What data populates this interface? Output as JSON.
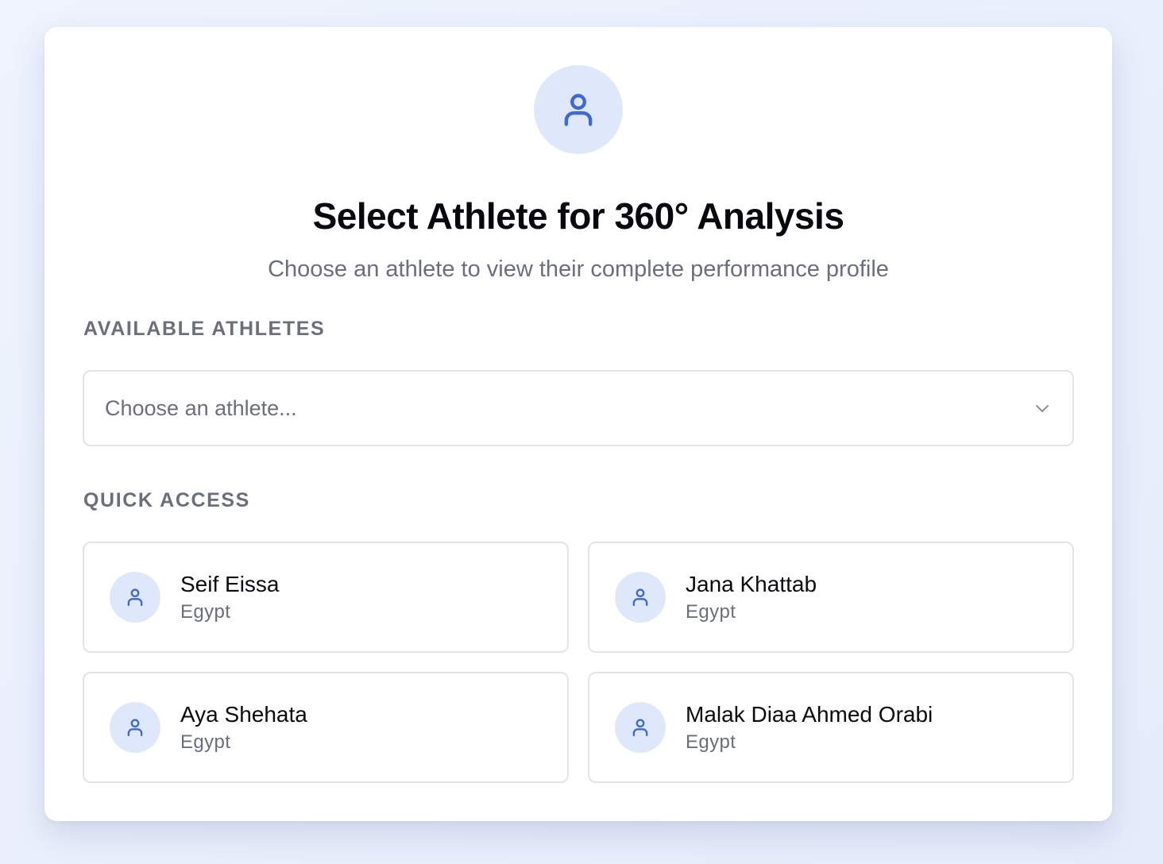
{
  "header": {
    "avatar_icon": "user-icon",
    "title": "Select Athlete for 360° Analysis",
    "subtitle": "Choose an athlete to view their complete performance profile"
  },
  "available": {
    "label": "AVAILABLE ATHLETES",
    "select_placeholder": "Choose an athlete...",
    "select_icon": "chevron-down-icon"
  },
  "quick_access": {
    "label": "QUICK ACCESS",
    "athletes": [
      {
        "name": "Seif Eissa",
        "country": "Egypt",
        "icon": "user-icon"
      },
      {
        "name": "Jana Khattab",
        "country": "Egypt",
        "icon": "user-icon"
      },
      {
        "name": "Aya Shehata",
        "country": "Egypt",
        "icon": "user-icon"
      },
      {
        "name": "Malak Diaa Ahmed Orabi",
        "country": "Egypt",
        "icon": "user-icon"
      }
    ]
  },
  "colors": {
    "accent": "#3b67e0",
    "avatar_bg": "#dfe8fb",
    "muted_text": "#6b6f7b",
    "border": "#e2e4ea"
  }
}
